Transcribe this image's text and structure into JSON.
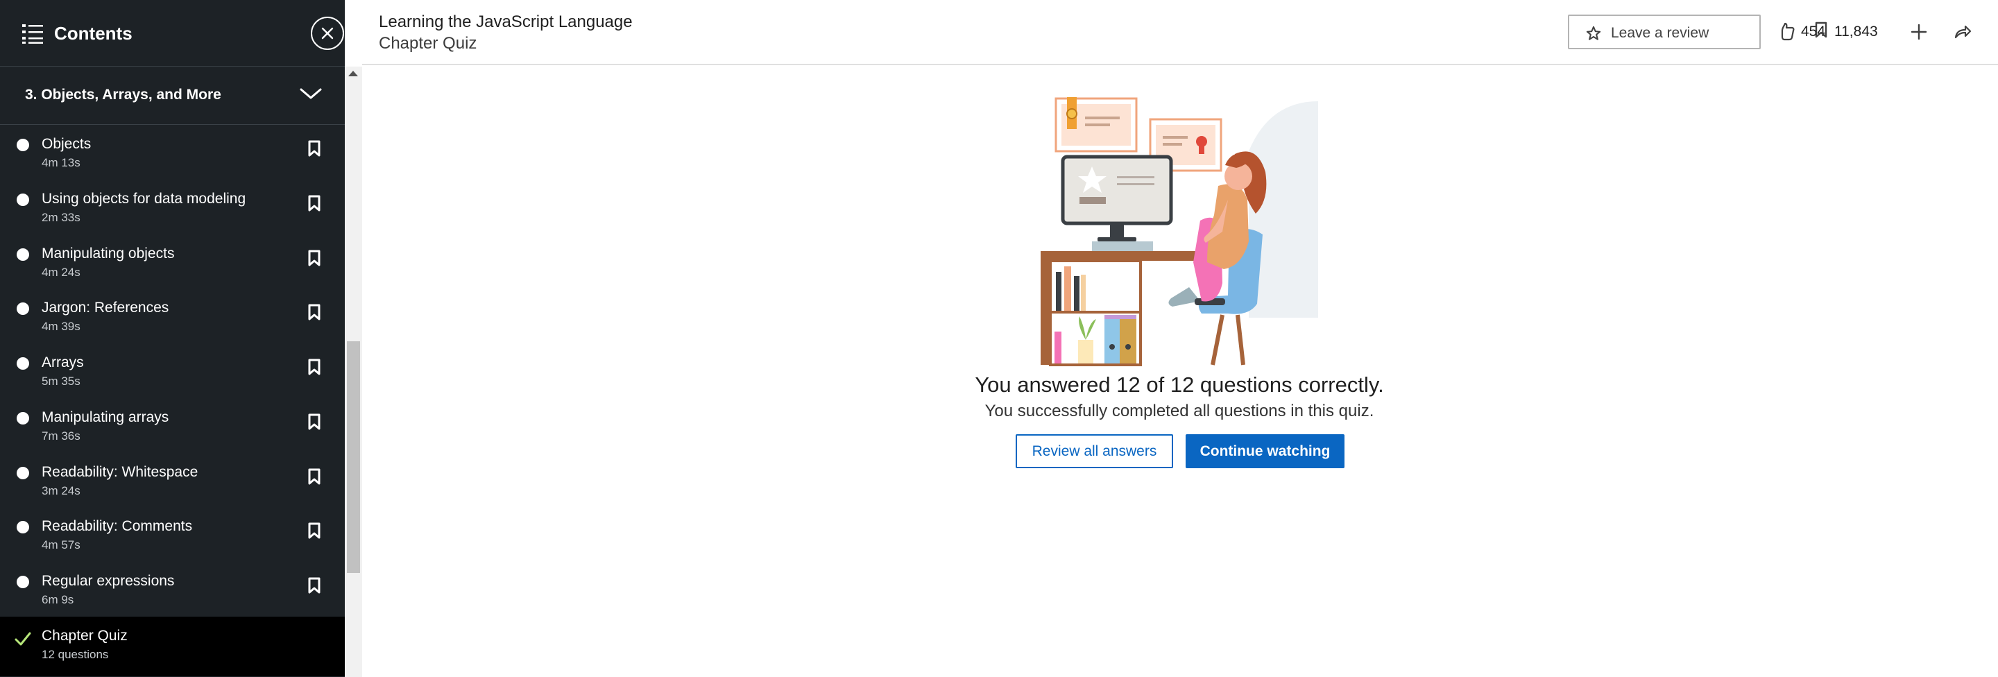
{
  "sidebar": {
    "title": "Contents",
    "list_icon": "list-icon",
    "close_icon": "close-icon",
    "section": {
      "title": "3. Objects, Arrays, and More",
      "chevron_icon": "chevron-down-icon"
    },
    "items": [
      {
        "title": "Objects",
        "duration": "4m 13s"
      },
      {
        "title": "Using objects for data modeling",
        "duration": "2m 33s"
      },
      {
        "title": "Manipulating objects",
        "duration": "4m 24s"
      },
      {
        "title": "Jargon: References",
        "duration": "4m 39s"
      },
      {
        "title": "Arrays",
        "duration": "5m 35s"
      },
      {
        "title": "Manipulating arrays",
        "duration": "7m 36s"
      },
      {
        "title": "Readability: Whitespace",
        "duration": "3m 24s"
      },
      {
        "title": "Readability: Comments",
        "duration": "4m 57s"
      },
      {
        "title": "Regular expressions",
        "duration": "6m 9s"
      }
    ],
    "active_item": {
      "title": "Chapter Quiz",
      "subtitle": "12 questions",
      "status_icon": "checkmark-icon"
    }
  },
  "header": {
    "course_title": "Learning the JavaScript Language",
    "chapter_title": "Chapter Quiz",
    "review_button": "Leave a review",
    "likes": "454",
    "saves": "11,843"
  },
  "main": {
    "result_heading": "You answered 12 of 12 questions correctly.",
    "result_subtext": "You successfully completed all questions in this quiz.",
    "review_answers_button": "Review all answers",
    "continue_button": "Continue watching"
  },
  "colors": {
    "sidebar_bg": "#1d2226",
    "accent": "#0a66c2",
    "check": "#b6e67a"
  }
}
